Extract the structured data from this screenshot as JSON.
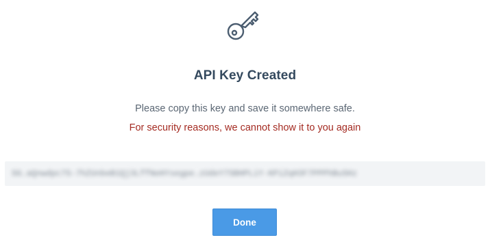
{
  "dialog": {
    "icon": "key-icon",
    "title": "API Key Created",
    "subtitle": "Please copy this key and save it somewhere safe.",
    "warning": "For security reasons, we cannot show it to you again",
    "api_key_masked": "SG.aQnwdpc7S-7hZUnbeB1Qj3LffNeHYsegpe.zUdeY7SBHPLiY-KPiZqH3F7PPPhBuSHz",
    "done_label": "Done"
  },
  "colors": {
    "title": "#34495e",
    "subtitle": "#5a6673",
    "warning": "#a42b22",
    "key_field_bg": "#f2f4f6",
    "button_bg": "#4a9ae6",
    "icon_stroke": "#4b5d70"
  }
}
